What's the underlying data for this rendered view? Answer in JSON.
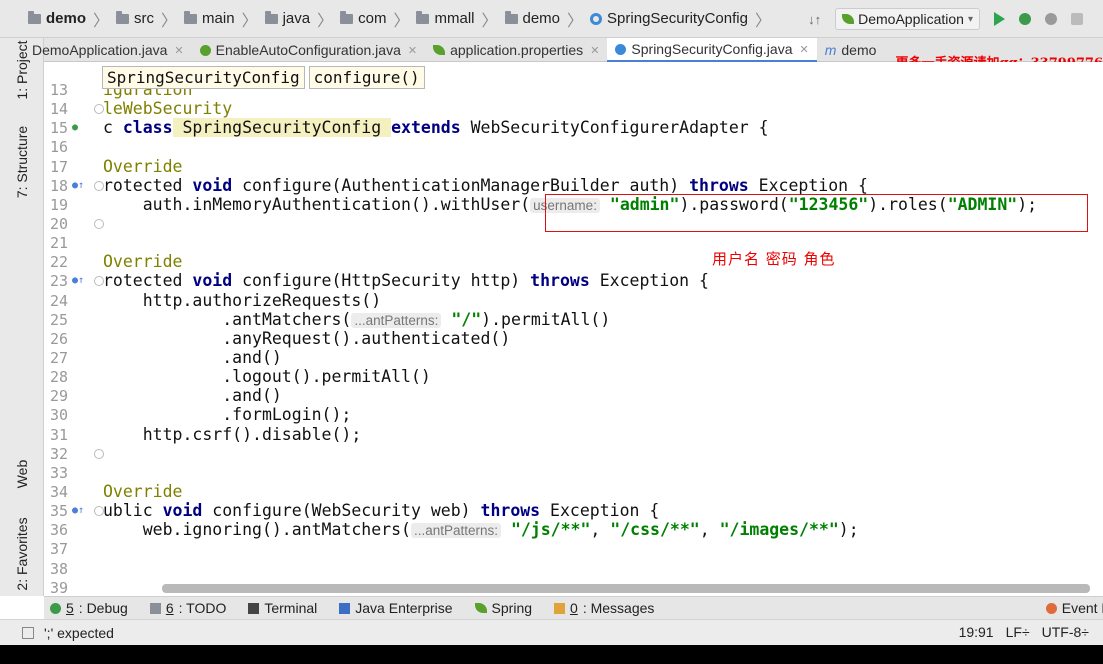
{
  "navbar": {
    "breadcrumbs": [
      "demo",
      "src",
      "main",
      "java",
      "com",
      "mmall",
      "demo",
      "SpringSecurityConfig"
    ],
    "run_config": "DemoApplication"
  },
  "sidebar": {
    "top_tabs": [
      "1: Project",
      "7: Structure"
    ],
    "bottom_tabs": [
      "Web",
      "2: Favorites"
    ]
  },
  "tabs": [
    {
      "label": "DemoApplication.java"
    },
    {
      "label": "EnableAutoConfiguration.java"
    },
    {
      "label": "application.properties"
    },
    {
      "label": "SpringSecurityConfig.java"
    },
    {
      "label": "demo"
    }
  ],
  "watermark": "更多一手资源请加qq：33799776",
  "editor": {
    "breadcrumb": [
      "SpringSecurityConfig",
      "configure()"
    ],
    "annotation_note": "用户名  密码  角色",
    "current_line": 19,
    "line_numbers": [
      "13",
      "14",
      "15",
      "16",
      "17",
      "18",
      "19",
      "20",
      "21",
      "22",
      "23",
      "24",
      "25",
      "26",
      "27",
      "28",
      "29",
      "30",
      "31",
      "32",
      "33",
      "34",
      "35",
      "36",
      "37",
      "38",
      "39"
    ],
    "code": {
      "l13": "iguration",
      "l14": "leWebSecurity",
      "l15_a": "c ",
      "l15_kw": "class",
      "l15_b": " SpringSecurityConfig ",
      "l15_kw2": "extends",
      "l15_c": " WebSecurityConfigurerAdapter {",
      "l17": "Override",
      "l18_a": "rotected ",
      "l18_kw": "void",
      "l18_b": " configure(AuthenticationManagerBuilder auth) ",
      "l18_kw2": "throws",
      "l18_c": " Exception {",
      "l19_a": "    auth.inMemoryAuthentication().withUser(",
      "l19_hint": "username:",
      "l19_s1": "\"admin\"",
      "l19_b": ").password(",
      "l19_s2": "\"123456\"",
      "l19_c": ").roles(",
      "l19_s3": "\"ADMIN\"",
      "l19_d": ");",
      "l22": "Override",
      "l23_a": "rotected ",
      "l23_kw": "void",
      "l23_b": " configure(HttpSecurity http) ",
      "l23_kw2": "throws",
      "l23_c": " Exception {",
      "l24": "    http.authorizeRequests()",
      "l25_a": "            .antMatchers(",
      "l25_hint": "...antPatterns:",
      "l25_s": "\"/\"",
      "l25_b": ").permitAll()",
      "l26": "            .anyRequest().authenticated()",
      "l27": "            .and()",
      "l28": "            .logout().permitAll()",
      "l29": "            .and()",
      "l30": "            .formLogin();",
      "l31": "    http.csrf().disable();",
      "l34": "Override",
      "l35_a": "ublic ",
      "l35_kw": "void",
      "l35_b": " configure(WebSecurity web) ",
      "l35_kw2": "throws",
      "l35_c": " Exception {",
      "l36_a": "    web.ignoring().antMatchers(",
      "l36_hint": "...antPatterns:",
      "l36_s1": "\"/js/**\"",
      "l36_b": ", ",
      "l36_s2": "\"/css/**\"",
      "l36_c": ", ",
      "l36_s3": "\"/images/**\"",
      "l36_d": ");"
    }
  },
  "toolwindows": [
    {
      "num": "5",
      "label": ": Debug"
    },
    {
      "num": "6",
      "label": ": TODO"
    },
    {
      "num": "",
      "label": "Terminal"
    },
    {
      "num": "",
      "label": "Java Enterprise"
    },
    {
      "num": "",
      "label": "Spring"
    },
    {
      "num": "0",
      "label": ": Messages"
    }
  ],
  "event_log": "Event Lo",
  "status": {
    "message": "';' expected",
    "position": "19:91",
    "line_sep": "LF÷",
    "encoding": "UTF-8÷"
  },
  "colors": {
    "keyword": "#000080",
    "string": "#008000",
    "annotation": "#808000",
    "highlight_box": "#dd1111"
  }
}
